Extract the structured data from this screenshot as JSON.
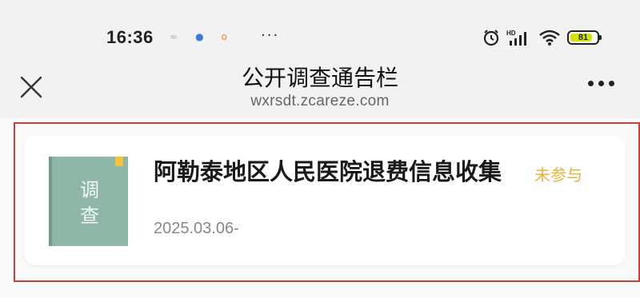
{
  "status_bar": {
    "time": "16:36",
    "more": "···",
    "battery_level": "81",
    "icons": [
      "notification-icon",
      "notification-icon",
      "notification-icon",
      "alarm-icon",
      "signal-icon",
      "wifi-icon",
      "battery-icon"
    ]
  },
  "header": {
    "title": "公开调查通告栏",
    "url": "wxrsdt.zcareze.com"
  },
  "survey": {
    "cover_label": "调查",
    "title": "阿勒泰地区人民医院退费信息收集",
    "status": "未参与",
    "date": "2025.03.06-"
  },
  "colors": {
    "highlight": "#d53a3a",
    "status": "#e8b43c",
    "cover": "#8fb7a8"
  }
}
